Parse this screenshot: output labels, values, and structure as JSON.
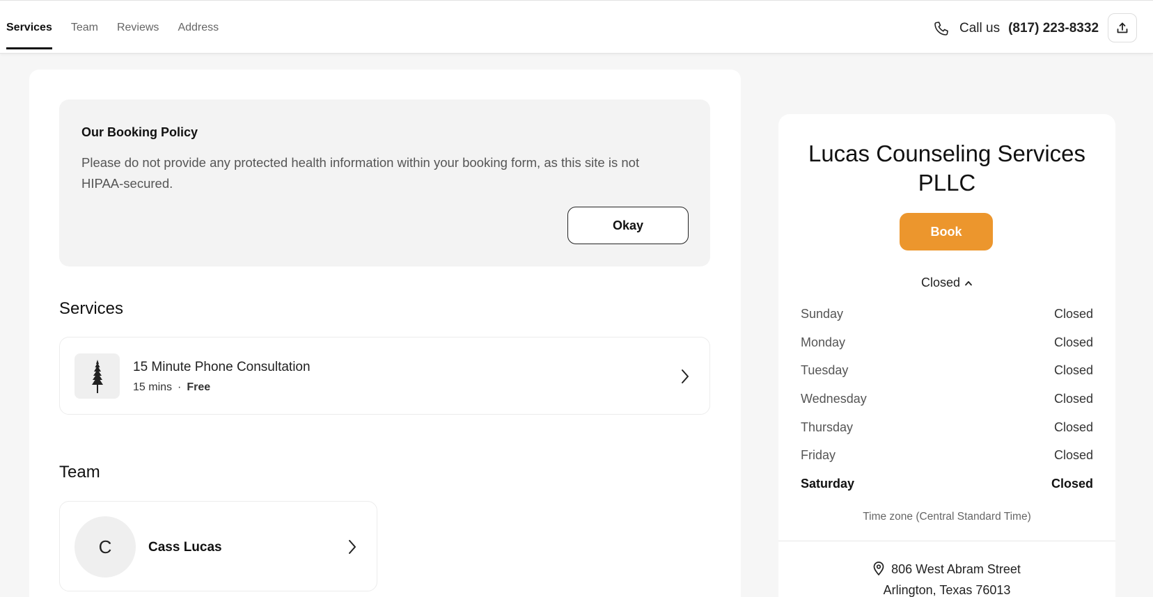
{
  "nav": {
    "tabs": [
      {
        "label": "Services",
        "active": true
      },
      {
        "label": "Team",
        "active": false
      },
      {
        "label": "Reviews",
        "active": false
      },
      {
        "label": "Address",
        "active": false
      }
    ],
    "call_label": "Call us",
    "phone": "(817) 223-8332",
    "icons": {
      "phone": "phone-icon",
      "share": "share-upload-icon"
    }
  },
  "policy": {
    "title": "Our Booking Policy",
    "text": "Please do not provide any protected health information within your booking form, as this site is not HIPAA-secured.",
    "okay_label": "Okay"
  },
  "services": {
    "heading": "Services",
    "items": [
      {
        "name": "15 Minute Phone Consultation",
        "duration": "15 mins",
        "separator": "·",
        "price": "Free",
        "thumb_icon": "pine-tree-icon"
      }
    ]
  },
  "team": {
    "heading": "Team",
    "members": [
      {
        "initial": "C",
        "name": "Cass Lucas"
      }
    ]
  },
  "business": {
    "name": "Lucas Counseling Services PLLC",
    "book_label": "Book",
    "brand_color": "#ec962d",
    "status": "Closed",
    "hours": [
      {
        "day": "Sunday",
        "value": "Closed"
      },
      {
        "day": "Monday",
        "value": "Closed"
      },
      {
        "day": "Tuesday",
        "value": "Closed"
      },
      {
        "day": "Wednesday",
        "value": "Closed"
      },
      {
        "day": "Thursday",
        "value": "Closed"
      },
      {
        "day": "Friday",
        "value": "Closed"
      },
      {
        "day": "Saturday",
        "value": "Closed",
        "today": true
      }
    ],
    "timezone": "Time zone (Central Standard Time)",
    "address_line1": "806 West Abram Street",
    "address_line2": "Arlington, Texas 76013"
  }
}
